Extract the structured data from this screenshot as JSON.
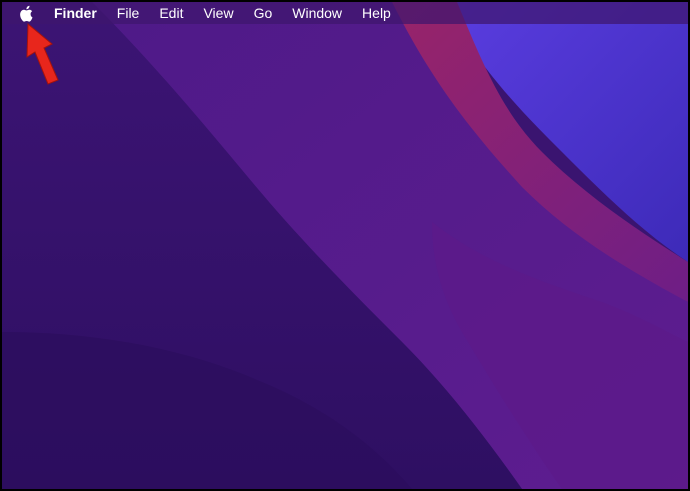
{
  "menubar": {
    "apple_icon": "apple-logo-icon",
    "app_name": "Finder",
    "items": [
      {
        "label": "File"
      },
      {
        "label": "Edit"
      },
      {
        "label": "View"
      },
      {
        "label": "Go"
      },
      {
        "label": "Window"
      },
      {
        "label": "Help"
      }
    ]
  },
  "annotation": {
    "icon": "arrow-up-left-icon",
    "color": "#e8261c"
  },
  "wallpaper": {
    "colors": [
      "#3b1472",
      "#4a1a82",
      "#6a1f8e",
      "#8a2272",
      "#4a3ac8"
    ]
  }
}
